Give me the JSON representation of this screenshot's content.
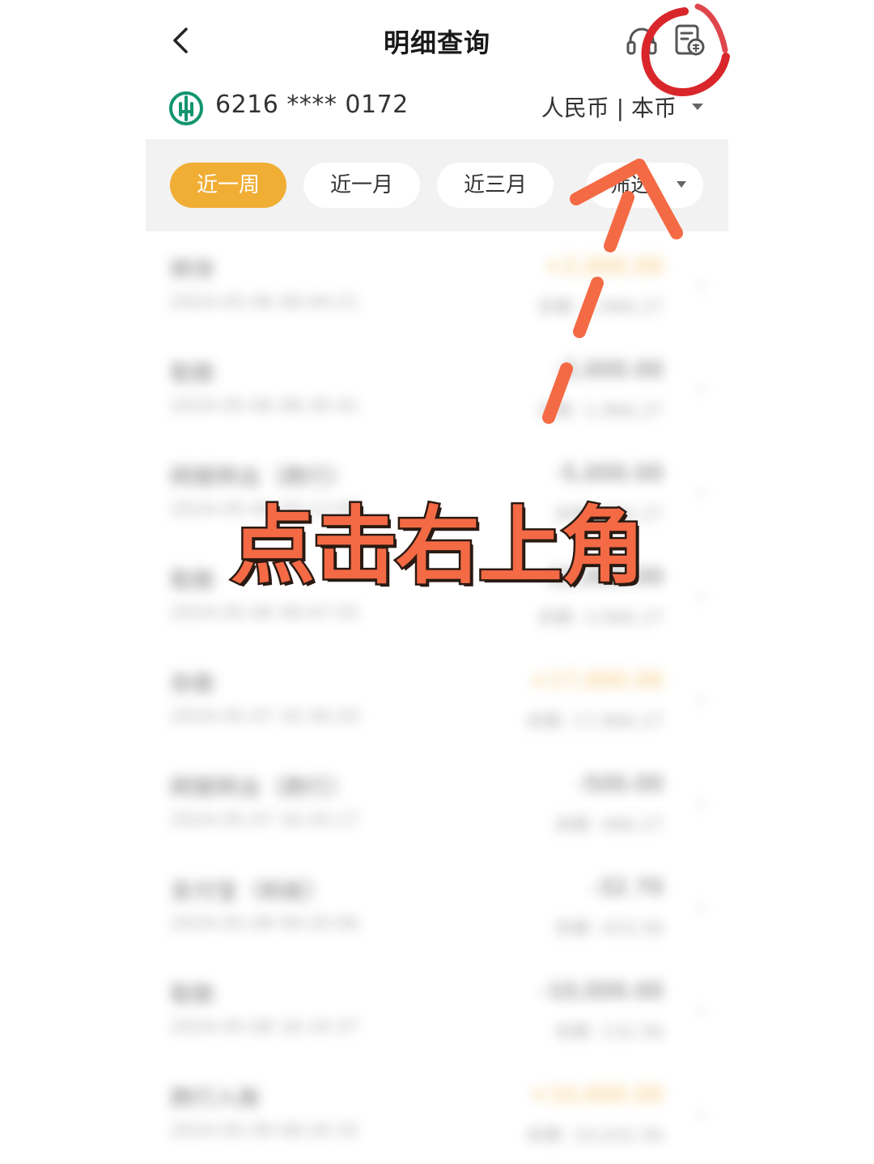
{
  "header": {
    "title": "明细查询",
    "back_icon": "chevron-left-icon",
    "service_icon": "headset-icon",
    "statement_icon": "statement-document-icon"
  },
  "account": {
    "bank_logo": "abc-bank-logo",
    "number": "6216 **** 0172",
    "currency": "人民币 | 本币"
  },
  "filters": {
    "tabs": [
      {
        "label": "近一周",
        "active": true
      },
      {
        "label": "近一月",
        "active": false
      },
      {
        "label": "近三月",
        "active": false
      }
    ],
    "filter_label": "筛选"
  },
  "transactions": [
    {
      "title": "转存",
      "amount": "+2,000.00",
      "date": "2024-05-06 06:04:21",
      "balance": "余额: 2,966.27",
      "type": "credit"
    },
    {
      "title": "取款",
      "amount": "-2,000.00",
      "date": "2024-05-06 08:30:41",
      "balance": "余额: 1,966.27",
      "type": "debit"
    },
    {
      "title": "网银转出（跨行）",
      "amount": "-5,000.00",
      "date": "2024-05-06 09:12:08",
      "balance": "余额: 966.27",
      "type": "debit"
    },
    {
      "title": "取款",
      "amount": "-15,000.00",
      "date": "2024-05-06 09:47:55",
      "balance": "余额: 3,966.27",
      "type": "debit"
    },
    {
      "title": "存款",
      "amount": "+17,000.00",
      "date": "2024-05-07 10:30:20",
      "balance": "余额: 17,966.27",
      "type": "credit"
    },
    {
      "title": "网银转出（跨行）",
      "amount": "-500.00",
      "date": "2024-05-07 16:20:17",
      "balance": "余额: 466.27",
      "type": "debit"
    },
    {
      "title": "支付宝（蚂蚁）",
      "amount": "-32.70",
      "date": "2024-05-08 09:20:06",
      "balance": "余额: 433.56",
      "type": "debit"
    },
    {
      "title": "取款",
      "amount": "-10,000.00",
      "date": "2024-05-08 16:10:37",
      "balance": "余额: 132.56",
      "type": "debit"
    },
    {
      "title": "跨行入账",
      "amount": "+10,000.00",
      "date": "2024-05-09 08:20:32",
      "balance": "余额: 10,032.56",
      "type": "credit"
    }
  ],
  "annotation": {
    "text": "点击右上角",
    "color": "#f46a45"
  }
}
